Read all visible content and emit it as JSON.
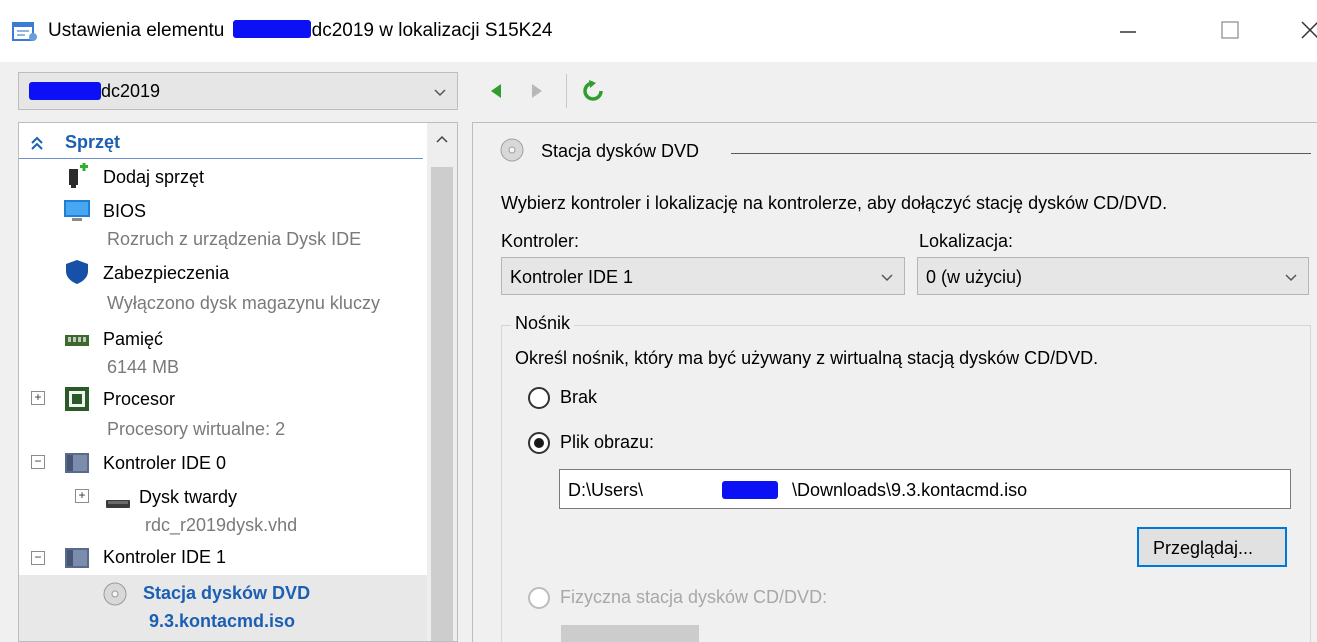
{
  "window": {
    "title_prefix": "Ustawienia elementu",
    "title_suffix": "dc2019 w lokalizacji S15K24",
    "accent": "#1b5fb4",
    "redaction_color": "#0b10f5"
  },
  "vm_selector": {
    "value": "dc2019"
  },
  "hardware": {
    "section_label": "Sprzęt",
    "items": [
      {
        "label": "Dodaj sprzęt",
        "icon": "add-hardware-icon"
      },
      {
        "label": "BIOS",
        "sub": "Rozruch z urządzenia Dysk IDE",
        "icon": "bios-icon"
      },
      {
        "label": "Zabezpieczenia",
        "sub": "Wyłączono dysk magazynu kluczy",
        "icon": "shield-icon"
      },
      {
        "label": "Pamięć",
        "sub": "6144 MB",
        "icon": "memory-icon"
      },
      {
        "label": "Procesor",
        "sub": "Procesory wirtualne: 2",
        "icon": "processor-icon",
        "expander": "+"
      },
      {
        "label": "Kontroler IDE 0",
        "icon": "ide-controller-icon",
        "expander": "−"
      },
      {
        "label": "Dysk twardy",
        "sub": "rdc_r2019dysk.vhd",
        "icon": "hard-disk-icon",
        "expander": "+"
      },
      {
        "label": "Kontroler IDE 1",
        "icon": "ide-controller-icon",
        "expander": "−"
      },
      {
        "label": "Stacja dysków DVD",
        "sub": "9.3.kontacmd.iso",
        "icon": "dvd-drive-icon",
        "selected": true
      }
    ]
  },
  "dvd": {
    "group_title": "Stacja dysków DVD",
    "description": "Wybierz kontroler i lokalizację na kontrolerze, aby dołączyć stację dysków CD/DVD.",
    "controller_label": "Kontroler:",
    "controller_value": "Kontroler IDE 1",
    "location_label": "Lokalizacja:",
    "location_value": "0 (w użyciu)",
    "media": {
      "title": "Nośnik",
      "description": "Określ nośnik, który ma być używany z wirtualną stacją dysków CD/DVD.",
      "option_none": "Brak",
      "option_image": "Plik obrazu:",
      "selected_option": "image",
      "path_prefix": "D:\\Users\\",
      "path_suffix": "\\Downloads\\9.3.kontacmd.iso",
      "browse_label": "Przeglądaj...",
      "option_physical": "Fizyczna stacja dysków CD/DVD:"
    }
  }
}
